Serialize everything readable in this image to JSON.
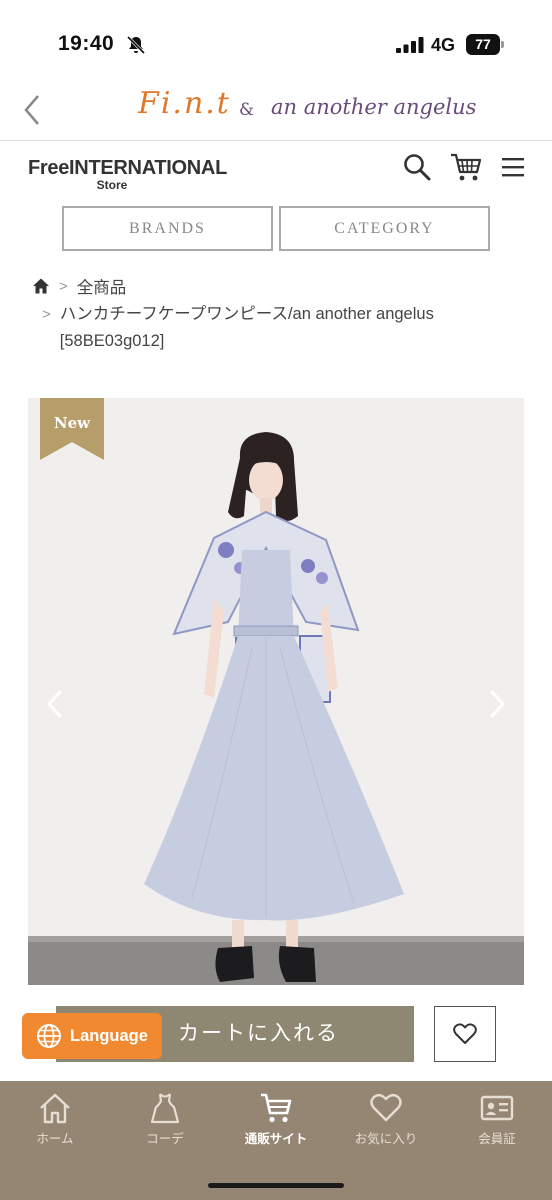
{
  "status_bar": {
    "time": "19:40",
    "network": "4G",
    "battery": "77"
  },
  "app_header": {
    "brand_left": "Fi.n.t",
    "brand_amp": "&",
    "brand_right": "an another angelus"
  },
  "store": {
    "logo_main": "FreeINTERNATIONAL",
    "logo_sub": "Store"
  },
  "nav": {
    "brands_label": "BRANDS",
    "category_label": "CATEGORY"
  },
  "breadcrumb": {
    "all_products": "全商品",
    "product_title": "ハンカチーフケープワンピース/an another angelus [58BE03g012]"
  },
  "product": {
    "badge": "New"
  },
  "actions": {
    "language_label": "Language",
    "cart_label": "カートに入れる"
  },
  "tab_bar": {
    "tabs": [
      {
        "label": "ホーム",
        "icon": "home-icon"
      },
      {
        "label": "コーデ",
        "icon": "dress-icon"
      },
      {
        "label": "通販サイト",
        "icon": "cart-icon"
      },
      {
        "label": "お気に入り",
        "icon": "heart-icon"
      },
      {
        "label": "会員証",
        "icon": "member-card-icon"
      }
    ],
    "active_index": 2
  },
  "colors": {
    "cart_button": "#8e8872",
    "language_button": "#f0892f",
    "tab_bar": "#958673",
    "badge_gold": "#b59e6a",
    "brand_orange": "#e0772a",
    "brand_purple": "#6a4a7a"
  }
}
